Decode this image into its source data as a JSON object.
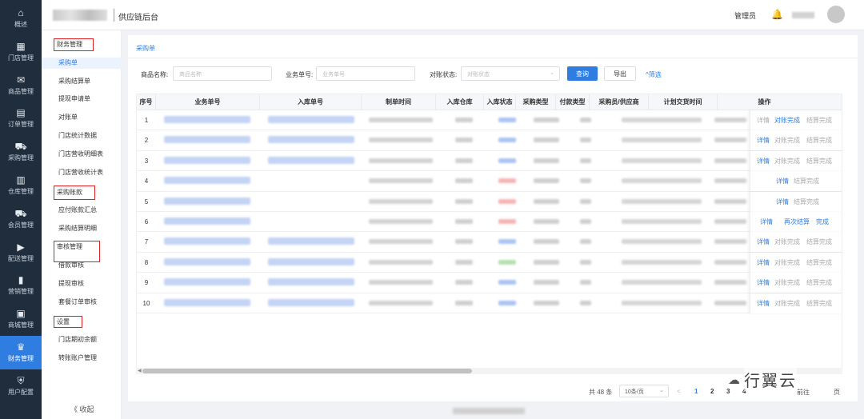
{
  "rail": [
    {
      "icon": "⌂",
      "label": "概述"
    },
    {
      "icon": "▦",
      "label": "门店管理"
    },
    {
      "icon": "✉",
      "label": "商品管理"
    },
    {
      "icon": "▤",
      "label": "订单管理"
    },
    {
      "icon": "⛟",
      "label": "采购管理"
    },
    {
      "icon": "▥",
      "label": "仓库管理"
    },
    {
      "icon": "⛟",
      "label": "会员管理"
    },
    {
      "icon": "▶",
      "label": "配送管理"
    },
    {
      "icon": "▮",
      "label": "营销管理"
    },
    {
      "icon": "▣",
      "label": "商城管理"
    },
    {
      "icon": "♛",
      "label": "财务管理"
    },
    {
      "icon": "⛨",
      "label": "用户配置"
    }
  ],
  "header": {
    "title": "供应链后台",
    "admin": "管理员",
    "bell": "🔔"
  },
  "menu": {
    "items": [
      {
        "label": "财务管理",
        "group": true
      },
      {
        "label": "采购单",
        "active": true
      },
      {
        "label": "采购结算单"
      },
      {
        "label": "提现申请单"
      },
      {
        "label": "对账单"
      },
      {
        "label": "门店统计数据"
      },
      {
        "label": "门店营收明细表"
      },
      {
        "label": "门店营收统计表"
      },
      {
        "label": "采购账款",
        "group": true
      },
      {
        "label": "应付账款汇总"
      },
      {
        "label": "采购结算明细"
      },
      {
        "label": "审核管理",
        "group": true
      },
      {
        "label": "借款审核"
      },
      {
        "label": "提现审核"
      },
      {
        "label": "套餐订单审核"
      },
      {
        "label": "设置",
        "group": true
      },
      {
        "label": "门店期初余额"
      },
      {
        "label": "转账账户管理"
      }
    ],
    "collapse": "《  收起"
  },
  "main": {
    "breadcrumb": "采购单",
    "filters": {
      "goods_label": "商品名称:",
      "goods_placeholder": "商品名称",
      "biz_label": "业务单号:",
      "biz_placeholder": "业务单号",
      "status_label": "对账状态:",
      "status_placeholder": "对账状态",
      "query": "查询",
      "export": "导出",
      "filter": "^筛选"
    },
    "columns": [
      "序号",
      "业务单号",
      "入库单号",
      "制单时间",
      "入库仓库",
      "入库状态",
      "采购类型",
      "付款类型",
      "采购员/供应商",
      "计划交货时间",
      "操作"
    ],
    "rows": [
      {
        "n": "1",
        "ops": [
          "详情",
          "对账完成",
          "结算完成"
        ],
        "c": [
          "grey",
          "blue",
          "grey"
        ],
        "status": "blue"
      },
      {
        "n": "2",
        "ops": [
          "详情",
          "对账完成",
          "结算完成"
        ],
        "c": [
          "blue",
          "grey",
          "grey"
        ],
        "status": "blue"
      },
      {
        "n": "3",
        "ops": [
          "详情",
          "对账完成",
          "结算完成"
        ],
        "c": [
          "blue",
          "grey",
          "grey"
        ],
        "status": "blue"
      },
      {
        "n": "4",
        "ops": [
          "详情",
          "结算完成"
        ],
        "c": [
          "blue",
          "grey"
        ],
        "status": "red"
      },
      {
        "n": "5",
        "ops": [
          "详情",
          "结算完成"
        ],
        "c": [
          "blue",
          "grey"
        ],
        "status": "red"
      },
      {
        "n": "6",
        "ops": [
          "详情",
          "再次结算",
          "完成"
        ],
        "c": [
          "blue",
          "blue",
          "blue"
        ],
        "status": "red"
      },
      {
        "n": "7",
        "ops": [
          "详情",
          "对账完成",
          "结算完成"
        ],
        "c": [
          "blue",
          "grey",
          "grey"
        ],
        "status": "blue"
      },
      {
        "n": "8",
        "ops": [
          "详情",
          "对账完成",
          "结算完成"
        ],
        "c": [
          "blue",
          "grey",
          "grey"
        ],
        "status": "green"
      },
      {
        "n": "9",
        "ops": [
          "详情",
          "对账完成",
          "结算完成"
        ],
        "c": [
          "blue",
          "grey",
          "grey"
        ],
        "status": "blue"
      },
      {
        "n": "10",
        "ops": [
          "详情",
          "对账完成",
          "结算完成"
        ],
        "c": [
          "blue",
          "grey",
          "grey"
        ],
        "status": "blue"
      }
    ],
    "pager": {
      "total": "共 48 条",
      "size": "10条/页",
      "prev": "<",
      "pages": [
        "1",
        "2",
        "3",
        "4"
      ],
      "goto": "前往",
      "page_unit": "页"
    }
  },
  "watermark": "行翼云"
}
